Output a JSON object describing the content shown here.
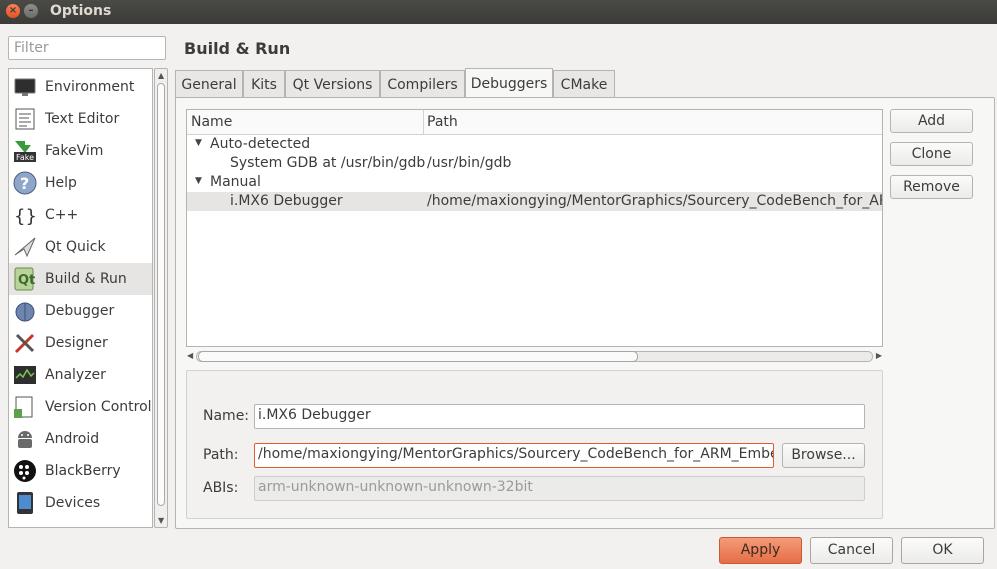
{
  "window": {
    "title": "Options"
  },
  "filter": {
    "placeholder": "Filter"
  },
  "categories": [
    {
      "label": "Environment",
      "icon": "monitor-icon"
    },
    {
      "label": "Text Editor",
      "icon": "text-editor-icon"
    },
    {
      "label": "FakeVim",
      "icon": "fakevim-icon"
    },
    {
      "label": "Help",
      "icon": "help-icon"
    },
    {
      "label": "C++",
      "icon": "braces-icon"
    },
    {
      "label": "Qt Quick",
      "icon": "qt-quick-icon"
    },
    {
      "label": "Build & Run",
      "icon": "build-run-icon",
      "selected": true
    },
    {
      "label": "Debugger",
      "icon": "debugger-icon"
    },
    {
      "label": "Designer",
      "icon": "designer-icon"
    },
    {
      "label": "Analyzer",
      "icon": "analyzer-icon"
    },
    {
      "label": "Version Control",
      "icon": "version-control-icon"
    },
    {
      "label": "Android",
      "icon": "android-icon"
    },
    {
      "label": "BlackBerry",
      "icon": "blackberry-icon"
    },
    {
      "label": "Devices",
      "icon": "devices-icon"
    }
  ],
  "page": {
    "title": "Build & Run"
  },
  "tabs": [
    {
      "label": "General"
    },
    {
      "label": "Kits"
    },
    {
      "label": "Qt Versions"
    },
    {
      "label": "Compilers"
    },
    {
      "label": "Debuggers",
      "active": true
    },
    {
      "label": "CMake"
    }
  ],
  "table": {
    "headers": {
      "name": "Name",
      "path": "Path"
    },
    "groups": [
      {
        "label": "Auto-detected",
        "rows": [
          {
            "name": "System GDB at /usr/bin/gdb",
            "path": "/usr/bin/gdb"
          }
        ]
      },
      {
        "label": "Manual",
        "rows": [
          {
            "name": "i.MX6 Debugger",
            "path": "/home/maxiongying/MentorGraphics/Sourcery_CodeBench_for_ARM_Embedded",
            "selected": true
          }
        ]
      }
    ]
  },
  "side_buttons": {
    "add": "Add",
    "clone": "Clone",
    "remove": "Remove"
  },
  "details": {
    "name_label": "Name:",
    "name_value": "i.MX6 Debugger",
    "path_label": "Path:",
    "path_value": "/home/maxiongying/MentorGraphics/Sourcery_CodeBench_for_ARM_Embedded",
    "browse": "Browse...",
    "abis_label": "ABIs:",
    "abis_value": "arm-unknown-unknown-unknown-32bit"
  },
  "footer": {
    "apply": "Apply",
    "cancel": "Cancel",
    "ok": "OK"
  }
}
